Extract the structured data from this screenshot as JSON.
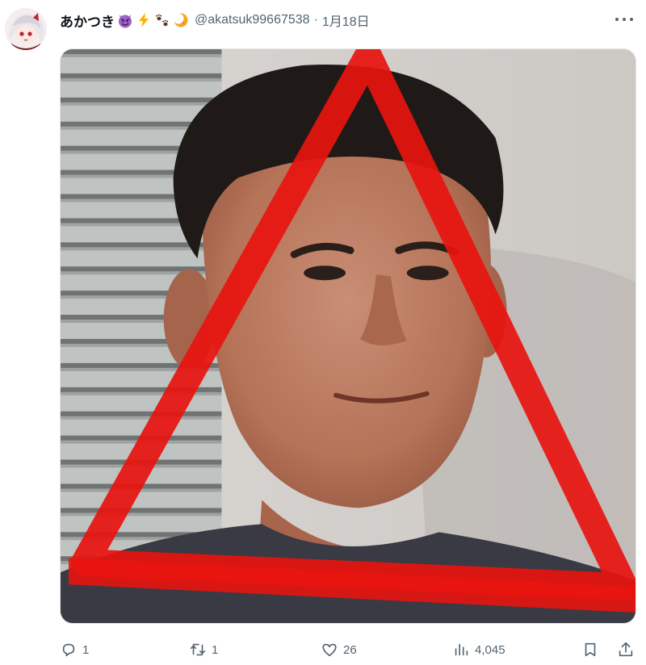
{
  "author": {
    "display_name": "あかつき",
    "emoji_badges": [
      "smiling-devil-emoji",
      "high-voltage-emoji",
      "paw-prints-emoji",
      "crescent-moon-emoji"
    ],
    "handle": "@akatsuk99667538",
    "separator": "·",
    "date": "1月18日"
  },
  "media": {
    "description_icon": "photo-with-red-triangle-drawn-over-face",
    "triangle_color": "#e8140f"
  },
  "actions": {
    "replies": "1",
    "retweets": "1",
    "likes": "26",
    "views": "4,045"
  },
  "colors": {
    "secondary_text": "#536471",
    "primary_text": "#0f1419"
  }
}
